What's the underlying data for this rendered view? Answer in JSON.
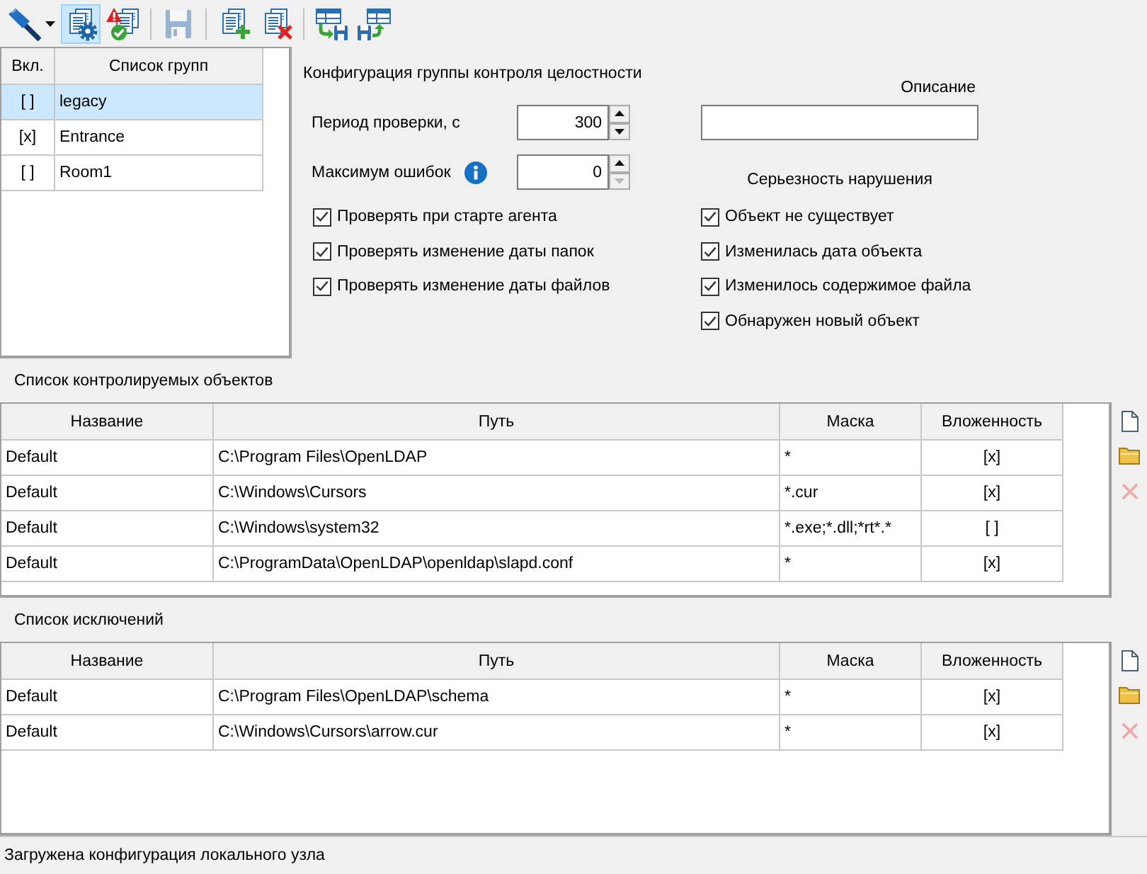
{
  "toolbar": {
    "groups": [
      {
        "buttons": [
          {
            "kind": "marker",
            "dropdown": true,
            "selected": false,
            "disabled": false
          },
          {
            "kind": "config",
            "dropdown": false,
            "selected": true,
            "disabled": false
          },
          {
            "kind": "warning",
            "dropdown": false,
            "selected": false,
            "disabled": false
          }
        ]
      },
      {
        "buttons": [
          {
            "kind": "save",
            "dropdown": false,
            "selected": false,
            "disabled": true
          }
        ]
      },
      {
        "buttons": [
          {
            "kind": "copy_add",
            "dropdown": false,
            "selected": false,
            "disabled": false
          },
          {
            "kind": "copy_remove",
            "dropdown": false,
            "selected": false,
            "disabled": false
          }
        ]
      },
      {
        "buttons": [
          {
            "kind": "table_save",
            "dropdown": false,
            "selected": false,
            "disabled": false
          },
          {
            "kind": "table_load",
            "dropdown": false,
            "selected": false,
            "disabled": false
          }
        ]
      }
    ]
  },
  "groups": {
    "columns": [
      "Вкл.",
      "Список групп"
    ],
    "rows": [
      {
        "enabled": "[ ]",
        "name": "legacy",
        "selected": true
      },
      {
        "enabled": "[x]",
        "name": "Entrance",
        "selected": false
      },
      {
        "enabled": "[ ]",
        "name": "Room1",
        "selected": false
      }
    ]
  },
  "config": {
    "title": "Конфигурация группы контроля целостности",
    "period": {
      "label": "Период проверки, с",
      "value": "300",
      "up_disabled": false,
      "down_disabled": false
    },
    "max_errors": {
      "label": "Максимум ошибок",
      "value": "0",
      "up_disabled": false,
      "down_disabled": true
    },
    "checks": [
      {
        "label": "Проверять при старте агента",
        "checked": true
      },
      {
        "label": "Проверять изменение даты папок",
        "checked": true
      },
      {
        "label": "Проверять изменение даты файлов",
        "checked": true
      }
    ],
    "description": {
      "label": "Описание"
    },
    "severity": {
      "title": "Серьезность нарушения",
      "checks": [
        {
          "label": "Объект не существует",
          "checked": true
        },
        {
          "label": "Изменилась дата объекта",
          "checked": true
        },
        {
          "label": "Изменилось содержимое файла",
          "checked": true
        },
        {
          "label": "Обнаружен новый объект",
          "checked": true
        }
      ]
    }
  },
  "objects": {
    "title": "Список контролируемых объектов",
    "columns": [
      "Название",
      "Путь",
      "Маска",
      "Вложенность"
    ],
    "rows": [
      {
        "name": "Default",
        "path": "C:\\Program Files\\OpenLDAP",
        "mask": "*",
        "recursive": "[x]"
      },
      {
        "name": "Default",
        "path": "C:\\Windows\\Cursors",
        "mask": "*.cur",
        "recursive": "[x]"
      },
      {
        "name": "Default",
        "path": "C:\\Windows\\system32",
        "mask": "*.exe;*.dll;*rt*.*",
        "recursive": "[ ]"
      },
      {
        "name": "Default",
        "path": "C:\\ProgramData\\OpenLDAP\\openldap\\slapd.conf",
        "mask": "*",
        "recursive": "[x]"
      }
    ],
    "actions": [
      {
        "kind": "new",
        "disabled": false
      },
      {
        "kind": "folder",
        "disabled": false
      },
      {
        "kind": "delete",
        "disabled": true
      }
    ]
  },
  "exclusions": {
    "title": "Список исключений",
    "columns": [
      "Название",
      "Путь",
      "Маска",
      "Вложенность"
    ],
    "rows": [
      {
        "name": "Default",
        "path": "C:\\Program Files\\OpenLDAP\\schema",
        "mask": "*",
        "recursive": "[x]"
      },
      {
        "name": "Default",
        "path": "C:\\Windows\\Cursors\\arrow.cur",
        "mask": "*",
        "recursive": "[x]"
      }
    ],
    "actions": [
      {
        "kind": "new",
        "disabled": false
      },
      {
        "kind": "folder",
        "disabled": false
      },
      {
        "kind": "delete",
        "disabled": true
      }
    ]
  },
  "status_bar": {
    "text": "Загружена конфигурация локального узла"
  }
}
